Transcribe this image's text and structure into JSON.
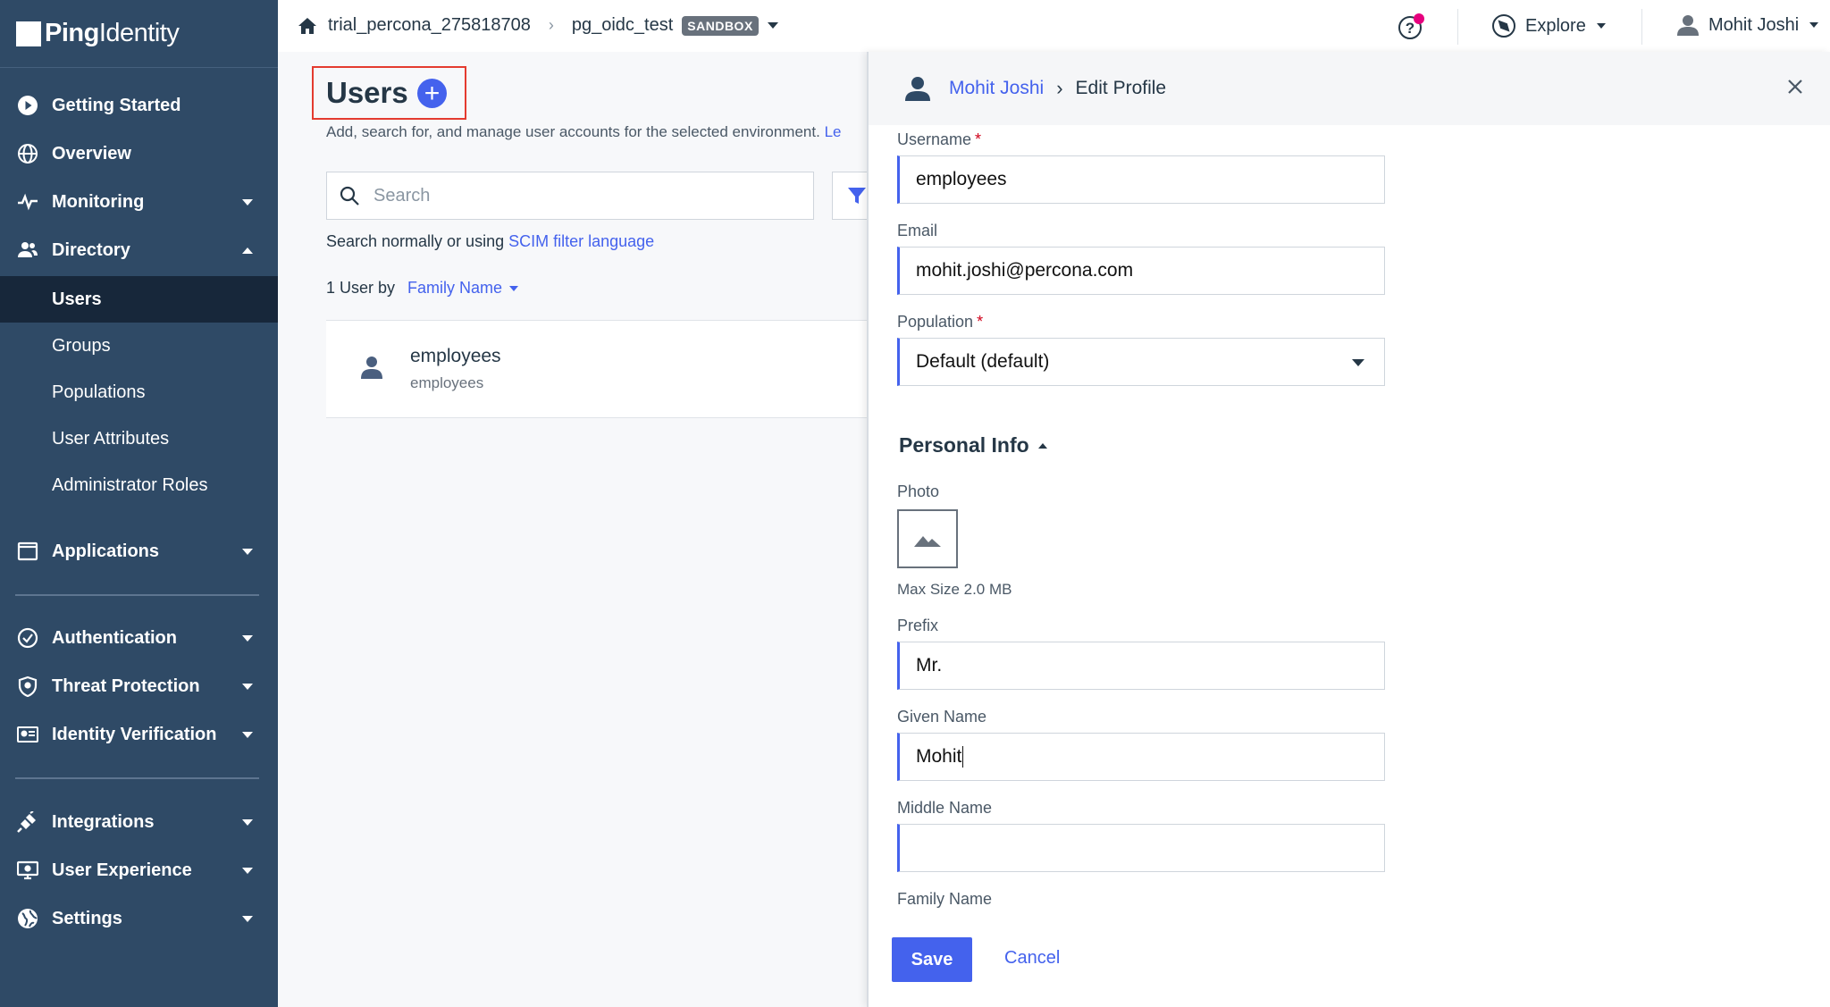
{
  "brand": {
    "bold": "Ping",
    "regular": "Identity"
  },
  "topbar": {
    "environment": "trial_percona_275818708",
    "app": "pg_oidc_test",
    "badge": "SANDBOX",
    "explore": "Explore",
    "user": "Mohit Joshi"
  },
  "sidebar": {
    "getting_started": "Getting Started",
    "overview": "Overview",
    "monitoring": "Monitoring",
    "directory": "Directory",
    "sub": [
      "Users",
      "Groups",
      "Populations",
      "User Attributes",
      "Administrator Roles"
    ],
    "applications": "Applications",
    "authentication": "Authentication",
    "threat_protection": "Threat Protection",
    "identity_verification": "Identity Verification",
    "integrations": "Integrations",
    "user_experience": "User Experience",
    "settings": "Settings"
  },
  "main": {
    "title": "Users",
    "add_symbol": "+",
    "description": "Add, search for, and manage user accounts for the selected environment.",
    "description_link": "Le",
    "search_placeholder": "Search",
    "search_help_prefix": "Search normally or using",
    "search_help_link": "SCIM filter language",
    "count_label": "1 User by",
    "sort_by": "Family Name",
    "users": [
      {
        "name": "employees",
        "sub": "employees"
      }
    ]
  },
  "panel": {
    "breadcrumb_user": "Mohit Joshi",
    "breadcrumb_page": "Edit Profile",
    "username_label": "Username",
    "username_value": "employees",
    "email_label": "Email",
    "email_value": "mohit.joshi@percona.com",
    "population_label": "Population",
    "population_value": "Default (default)",
    "required_mark": "*",
    "personal_info": "Personal Info",
    "photo_label": "Photo",
    "max_size": "Max Size 2.0 MB",
    "prefix_label": "Prefix",
    "prefix_value": "Mr.",
    "given_name_label": "Given Name",
    "given_name_value": "Mohit",
    "middle_name_label": "Middle Name",
    "middle_name_value": "",
    "family_name_label": "Family Name",
    "save": "Save",
    "cancel": "Cancel"
  },
  "colors": {
    "sidebar": "#2f4a66",
    "active": "#17273a",
    "accent": "#4462ed",
    "highlight_box": "#e43b2f",
    "notification": "#e6007e"
  }
}
